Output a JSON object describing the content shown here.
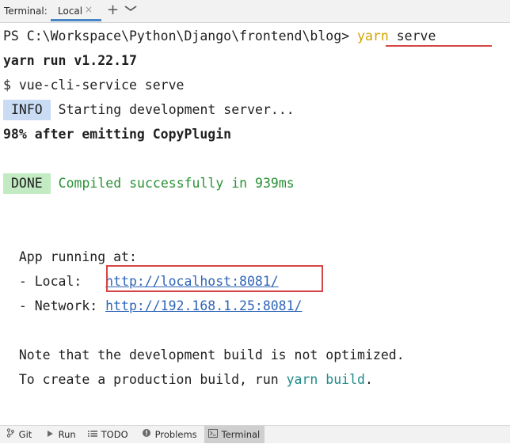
{
  "tabbar": {
    "title": "Terminal:",
    "tab_label": "Local",
    "close_glyph": "×",
    "add_glyph": "+",
    "menu_glyph": "⌄"
  },
  "terminal": {
    "prompt": "PS C:\\Workspace\\Python\\Django\\frontend\\blog> ",
    "cmd_yarn": "yarn",
    "cmd_arg": " serve",
    "line_yarn_run": "yarn run v1.22.17",
    "line_vue_cli": "$ vue-cli-service serve",
    "info_tag": "INFO",
    "info_text": " Starting development server...",
    "progress": "98% after emitting CopyPlugin",
    "done_tag": "DONE",
    "done_text": " Compiled successfully in 939ms",
    "app_running": "  App running at:",
    "local_label": "  - Local:   ",
    "local_url": "http://localhost:8081/",
    "network_label": "  - Network: ",
    "network_url": "http://192.168.1.25:8081/",
    "note": "  Note that the development build is not optimized.",
    "prod_prefix": "  To create a production build, run ",
    "prod_cmd": "yarn build",
    "prod_suffix": "."
  },
  "bottombar": {
    "items": [
      {
        "label": "Git",
        "icon": "git-branch-icon"
      },
      {
        "label": "Run",
        "icon": "run-icon"
      },
      {
        "label": "TODO",
        "icon": "todo-list-icon"
      },
      {
        "label": "Problems",
        "icon": "problems-icon"
      },
      {
        "label": "Terminal",
        "icon": "terminal-icon"
      }
    ]
  },
  "colors": {
    "yarn": "#d4a300",
    "success": "#2a9134",
    "link": "#2f65b6",
    "highlight": "#d64545",
    "info_bg": "#c9dcf4",
    "done_bg": "#c2eac3"
  }
}
